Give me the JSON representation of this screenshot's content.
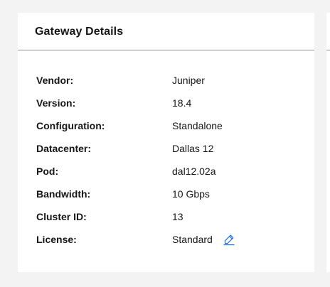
{
  "card": {
    "title": "Gateway Details",
    "details": [
      {
        "label": "Vendor:",
        "value": "Juniper"
      },
      {
        "label": "Version:",
        "value": "18.4"
      },
      {
        "label": "Configuration:",
        "value": "Standalone"
      },
      {
        "label": "Datacenter:",
        "value": "Dallas 12"
      },
      {
        "label": "Pod:",
        "value": "dal12.02a"
      },
      {
        "label": "Bandwidth:",
        "value": "10 Gbps"
      },
      {
        "label": "Cluster ID:",
        "value": "13"
      },
      {
        "label": "License:",
        "value": "Standard"
      }
    ],
    "license_edit_icon": "edit-pencil-icon"
  },
  "colors": {
    "background": "#f3f3f3",
    "card": "#ffffff",
    "divider": "#8d8d8d",
    "text": "#161616",
    "link": "#0f62fe"
  }
}
